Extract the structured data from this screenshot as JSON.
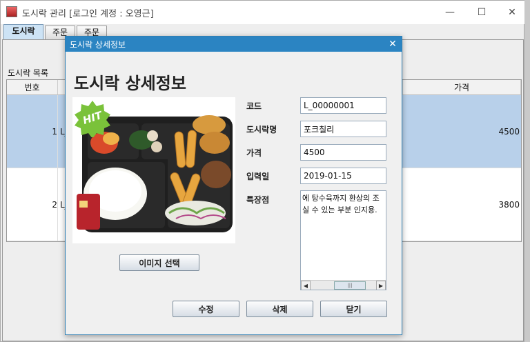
{
  "window": {
    "title": "도시락 관리 [로그인 계정 : 오영근]",
    "minimize": "—",
    "maximize": "☐",
    "close": "✕"
  },
  "tabs": [
    {
      "label": "도시락"
    },
    {
      "label": "주문"
    },
    {
      "label": "주문"
    }
  ],
  "list": {
    "label": "도시락 목록",
    "columns": {
      "no": "번호",
      "price": "가격"
    },
    "rows": [
      {
        "no": "1",
        "code": "L_",
        "price": "4500"
      },
      {
        "no": "2",
        "code": "L_",
        "price": "3800"
      }
    ]
  },
  "dialog": {
    "title": "도시락 상세정보",
    "heading": "도시락 상세정보",
    "badge": "HIT",
    "image_button": "이미지 선택",
    "fields": {
      "code": {
        "label": "코드",
        "value": "L_00000001"
      },
      "name": {
        "label": "도시락명",
        "value": "포크칠리"
      },
      "price": {
        "label": "가격",
        "value": "4500"
      },
      "date": {
        "label": "입력일",
        "value": "2019-01-15"
      },
      "desc": {
        "label": "특장점",
        "lines": [
          "에 탕수육까지 환상의 조",
          "실 수 있는 부분 인지용."
        ]
      }
    },
    "buttons": {
      "edit": "수정",
      "delete": "삭제",
      "close": "닫기"
    }
  },
  "colors": {
    "accent": "#2b84c2",
    "selection": "#b8d0ea",
    "badge": "#7ac23a"
  }
}
